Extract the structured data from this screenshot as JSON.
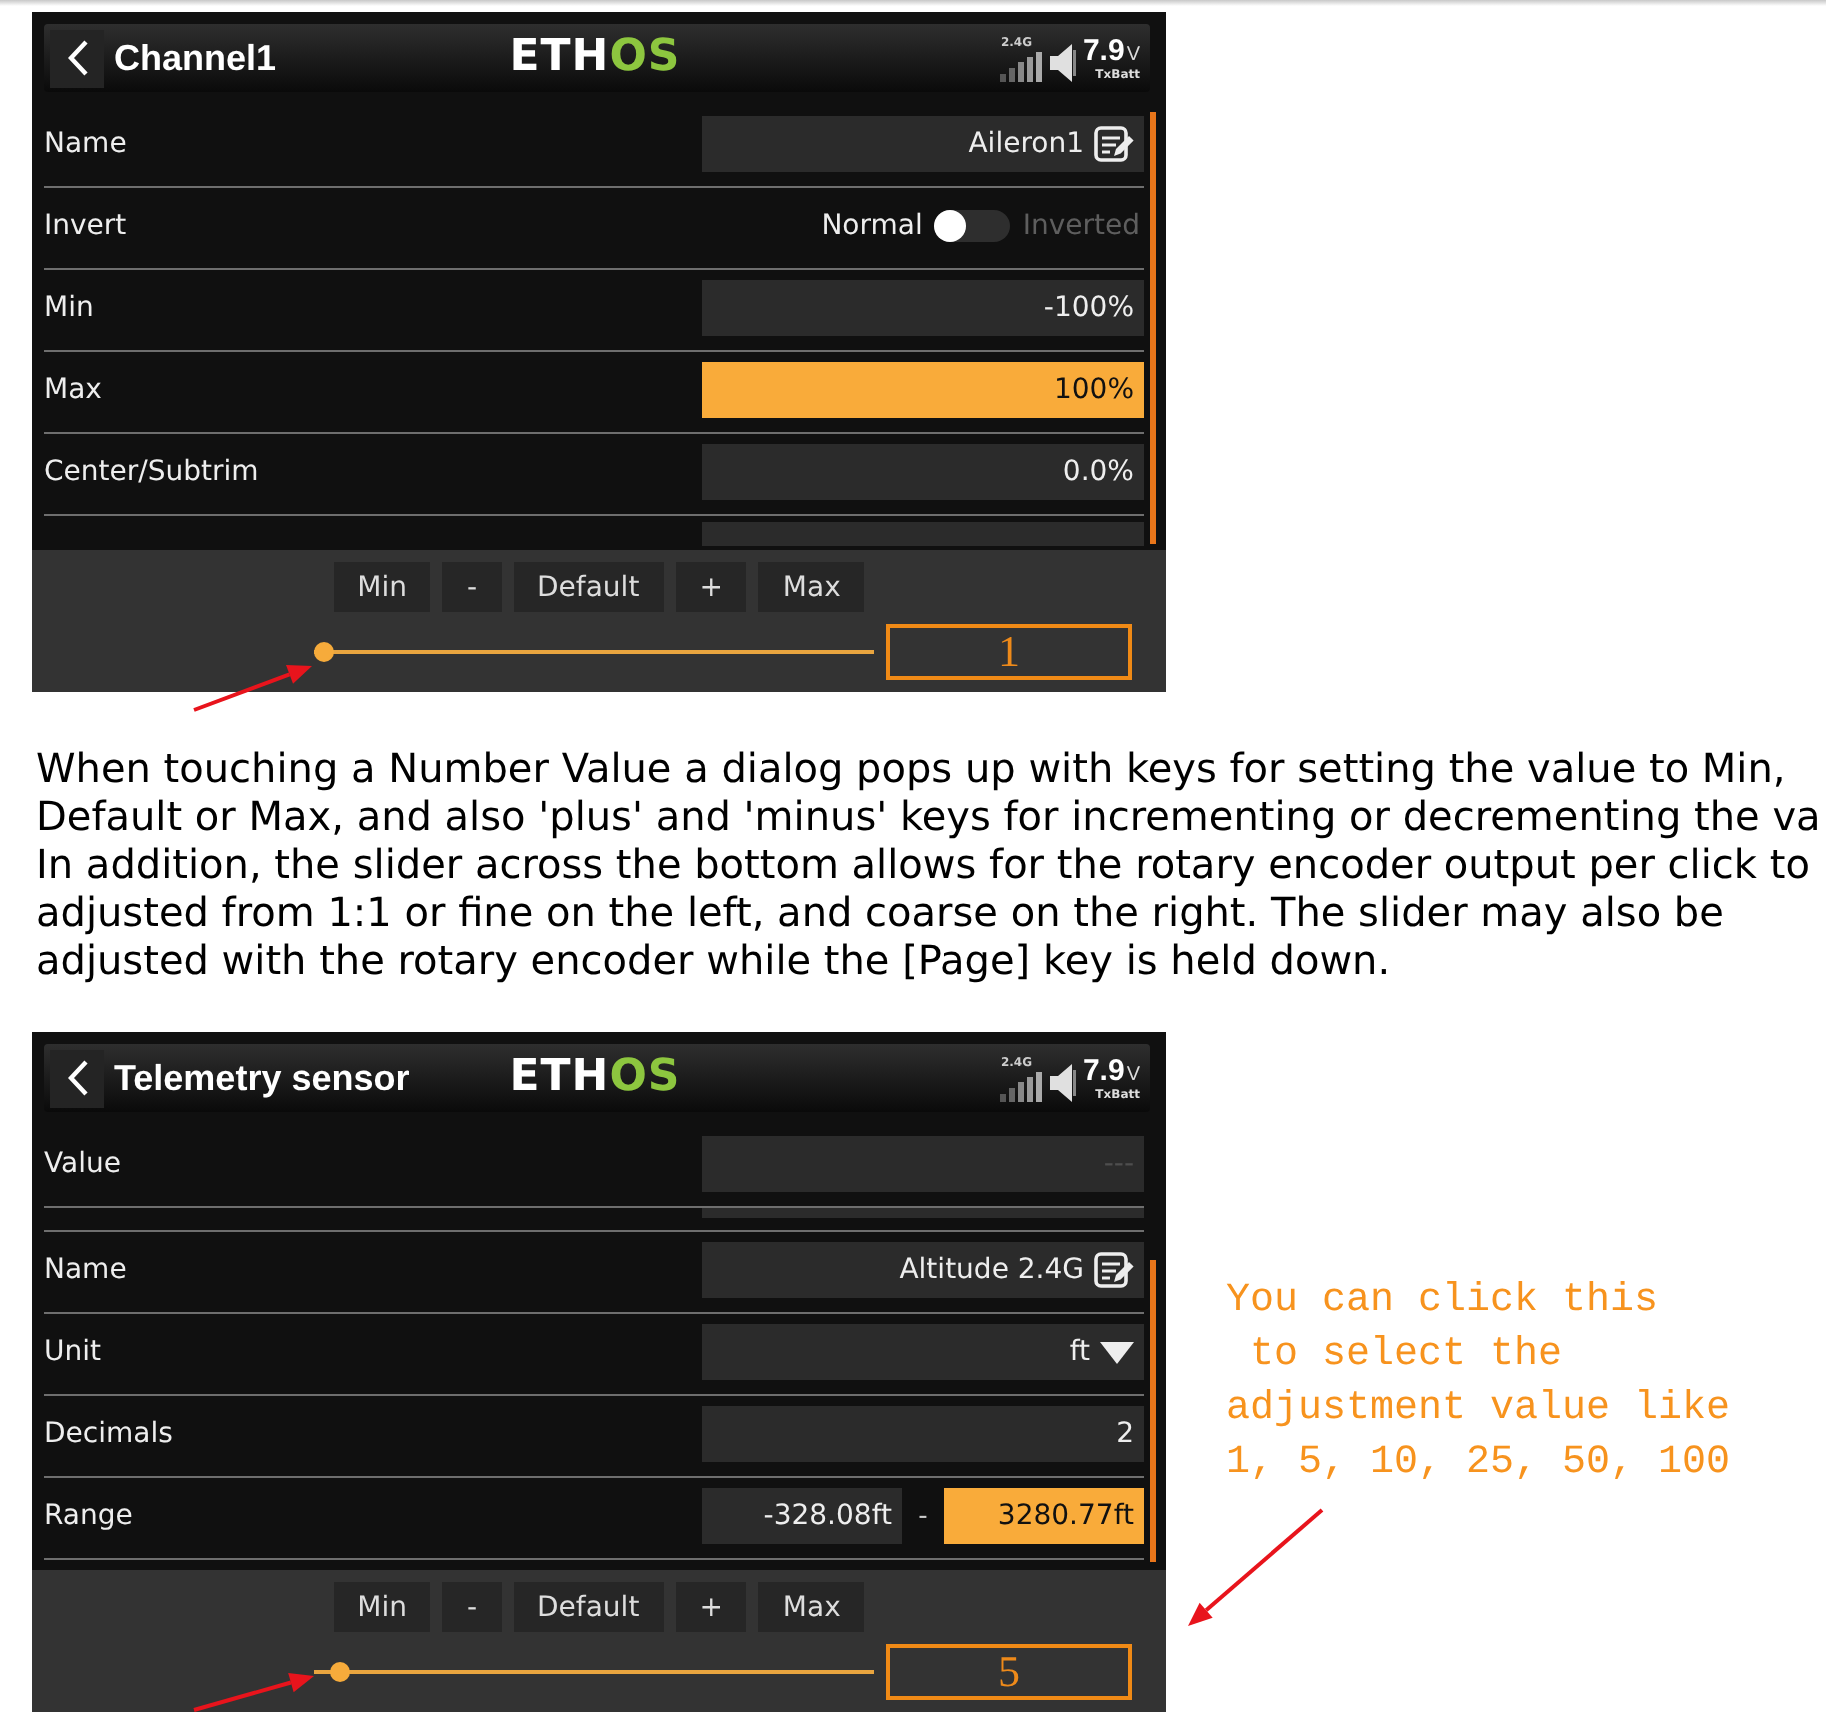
{
  "screens": [
    {
      "title": "Channel1",
      "logo": [
        {
          "text": "ETH",
          "color": "#ffffff"
        },
        {
          "text": "OS",
          "color": "#8dc63f"
        }
      ],
      "status": {
        "band": "2.4G",
        "voltage": "7.9",
        "unit": "V",
        "caption": "TxBatt"
      },
      "clipped_above": false,
      "rows": [
        {
          "kind": "text",
          "label": "Name",
          "value": "Aileron1",
          "selected": false
        },
        {
          "kind": "toggle",
          "label": "Invert",
          "off_label": "Normal",
          "on_label": "Inverted",
          "on": false
        },
        {
          "kind": "number",
          "label": "Min",
          "value": "-100%",
          "selected": false,
          "disabled": false
        },
        {
          "kind": "number",
          "label": "Max",
          "value": "100%",
          "selected": true,
          "disabled": false
        },
        {
          "kind": "number",
          "label": "Center/Subtrim",
          "value": "0.0%",
          "selected": false,
          "disabled": false
        }
      ],
      "clipped_below": true,
      "dialog": {
        "buttons": [
          "Min",
          "-",
          "Default",
          "+",
          "Max"
        ],
        "slider": {
          "level": 0
        },
        "step": "1"
      }
    },
    {
      "title": "Telemetry sensor",
      "logo": [
        {
          "text": "ETH",
          "color": "#ffffff"
        },
        {
          "text": "OS",
          "color": "#8dc63f"
        }
      ],
      "status": {
        "band": "2.4G",
        "voltage": "7.9",
        "unit": "V",
        "caption": "TxBatt"
      },
      "pinned_rows": [
        {
          "kind": "number",
          "label": "Value",
          "value": "---",
          "selected": false,
          "disabled": true
        }
      ],
      "clipped_above": true,
      "rows": [
        {
          "kind": "text",
          "label": "Name",
          "value": "Altitude 2.4G",
          "selected": false
        },
        {
          "kind": "dropdown",
          "label": "Unit",
          "value": "ft",
          "selected": false
        },
        {
          "kind": "number",
          "label": "Decimals",
          "value": "2",
          "selected": false,
          "disabled": false
        },
        {
          "kind": "range",
          "label": "Range",
          "separator": "-",
          "fields": [
            {
              "value": "-328.08ft",
              "selected": false
            },
            {
              "value": "3280.77ft",
              "selected": true
            }
          ]
        }
      ],
      "clipped_below": false,
      "dialog": {
        "buttons": [
          "Min",
          "-",
          "Default",
          "+",
          "Max"
        ],
        "slider": {
          "level": 0.03
        },
        "step": "5"
      }
    }
  ],
  "paragraph": {
    "lines": [
      "When touching a Number Value a dialog pops up with keys for setting the value to Min,",
      "Default or Max, and also 'plus' and 'minus' keys for incrementing or decrementing the va",
      "In addition, the slider across the bottom allows for the rotary encoder output per click to",
      "adjusted from 1:1 or fine on the left, and coarse on the right. The slider may also be",
      "adjusted with the rotary encoder while the [Page] key is held down."
    ]
  },
  "note": {
    "lines": [
      "You can click this",
      " to select the",
      "adjustment value like",
      "1, 5, 10, 25, 50, 100"
    ]
  }
}
